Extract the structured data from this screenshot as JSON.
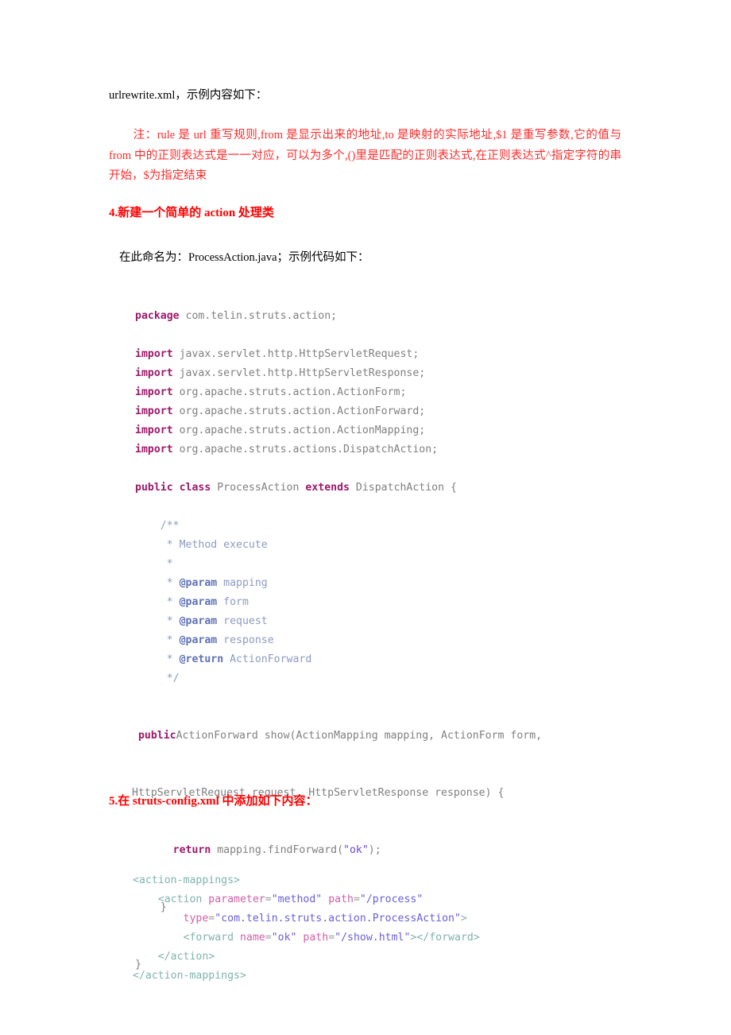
{
  "document": {
    "intro_line": "urlrewrite.xml，示例内容如下：",
    "note_paragraph": "注：rule 是 url 重写规则,from 是显示出来的地址,to 是映射的实际地址,$1 是重写参数,它的值与 from 中的正则表达式是一一对应，可以为多个,()里是匹配的正则表达式,在正则表达式^指定字符的串开始，$为指定结束",
    "section4_heading": "4.新建一个简单的 action 处理类",
    "section4_subtext": "在此命名为：ProcessAction.java；示例代码如下：",
    "section5_heading": "5.在 struts-config.xml 中添加如下内容："
  },
  "java_code": {
    "lines": [
      [
        {
          "t": "package",
          "c": "kw"
        },
        {
          "t": " com.telin.struts.action;",
          "c": "plain"
        }
      ],
      [],
      [
        {
          "t": "import",
          "c": "kw"
        },
        {
          "t": " javax.servlet.http.HttpServletRequest;",
          "c": "plain"
        }
      ],
      [
        {
          "t": "import",
          "c": "kw"
        },
        {
          "t": " javax.servlet.http.HttpServletResponse;",
          "c": "plain"
        }
      ],
      [
        {
          "t": "import",
          "c": "kw"
        },
        {
          "t": " org.apache.struts.action.ActionForm;",
          "c": "plain"
        }
      ],
      [
        {
          "t": "import",
          "c": "kw"
        },
        {
          "t": " org.apache.struts.action.ActionForward;",
          "c": "plain"
        }
      ],
      [
        {
          "t": "import",
          "c": "kw"
        },
        {
          "t": " org.apache.struts.action.ActionMapping;",
          "c": "plain"
        }
      ],
      [
        {
          "t": "import",
          "c": "kw"
        },
        {
          "t": " org.apache.struts.actions.DispatchAction;",
          "c": "plain"
        }
      ],
      [],
      [
        {
          "t": "public class",
          "c": "kw"
        },
        {
          "t": " ProcessAction ",
          "c": "plain"
        },
        {
          "t": "extends",
          "c": "kw"
        },
        {
          "t": " DispatchAction {",
          "c": "plain"
        }
      ],
      [],
      [
        {
          "t": "    /**",
          "c": "cmt"
        }
      ],
      [
        {
          "t": "     * Method execute",
          "c": "cmt"
        }
      ],
      [
        {
          "t": "     *",
          "c": "cmt"
        }
      ],
      [
        {
          "t": "     * ",
          "c": "cmt"
        },
        {
          "t": "@param",
          "c": "cmt-tag"
        },
        {
          "t": " mapping",
          "c": "cmt"
        }
      ],
      [
        {
          "t": "     * ",
          "c": "cmt"
        },
        {
          "t": "@param",
          "c": "cmt-tag"
        },
        {
          "t": " form",
          "c": "cmt"
        }
      ],
      [
        {
          "t": "     * ",
          "c": "cmt"
        },
        {
          "t": "@param",
          "c": "cmt-tag"
        },
        {
          "t": " request",
          "c": "cmt"
        }
      ],
      [
        {
          "t": "     * ",
          "c": "cmt"
        },
        {
          "t": "@param",
          "c": "cmt-tag"
        },
        {
          "t": " response",
          "c": "cmt"
        }
      ],
      [
        {
          "t": "     * ",
          "c": "cmt"
        },
        {
          "t": "@return",
          "c": "cmt-tag"
        },
        {
          "t": " ActionForward",
          "c": "cmt"
        }
      ],
      [
        {
          "t": "     */",
          "c": "cmt"
        }
      ]
    ],
    "signature_line_1": [
      {
        "t": " ",
        "c": "plain"
      },
      {
        "t": "public",
        "c": "kw"
      },
      {
        "t": "ActionForward show(ActionMapping mapping, ActionForm form,",
        "c": "plain"
      }
    ],
    "signature_line_2": [
      {
        "t": "HttpServletRequest request, HttpServletResponse response) {",
        "c": "plain"
      }
    ],
    "return_line": [
      {
        "t": "      ",
        "c": "plain"
      },
      {
        "t": "return",
        "c": "kw"
      },
      {
        "t": " mapping.findForward(",
        "c": "plain"
      },
      {
        "t": "\"ok\"",
        "c": "str"
      },
      {
        "t": ");",
        "c": "plain"
      }
    ],
    "close_inner": "    }",
    "close_outer": "}"
  },
  "xml_code": {
    "lines": [
      [
        {
          "t": "<action-mappings>",
          "c": "xtag"
        }
      ],
      [
        {
          "t": "    <action ",
          "c": "xtag"
        },
        {
          "t": "parameter",
          "c": "xattr"
        },
        {
          "t": "=",
          "c": "xpunct"
        },
        {
          "t": "\"method\"",
          "c": "xval"
        },
        {
          "t": " ",
          "c": "plain"
        },
        {
          "t": "path",
          "c": "xattr"
        },
        {
          "t": "=",
          "c": "xpunct"
        },
        {
          "t": "\"/process\"",
          "c": "xval"
        }
      ],
      [
        {
          "t": "        ",
          "c": "plain"
        },
        {
          "t": "type",
          "c": "xattr"
        },
        {
          "t": "=",
          "c": "xpunct"
        },
        {
          "t": "\"com.telin.struts.action.ProcessAction\"",
          "c": "xval"
        },
        {
          "t": ">",
          "c": "xtag"
        }
      ],
      [
        {
          "t": "        <forward ",
          "c": "xtag"
        },
        {
          "t": "name",
          "c": "xattr"
        },
        {
          "t": "=",
          "c": "xpunct"
        },
        {
          "t": "\"ok\"",
          "c": "xval"
        },
        {
          "t": " ",
          "c": "plain"
        },
        {
          "t": "path",
          "c": "xattr"
        },
        {
          "t": "=",
          "c": "xpunct"
        },
        {
          "t": "\"/show.html\"",
          "c": "xval"
        },
        {
          "t": "></forward>",
          "c": "xtag"
        }
      ],
      [
        {
          "t": "    </action>",
          "c": "xtag"
        }
      ],
      [
        {
          "t": "</action-mappings>",
          "c": "xtag"
        }
      ]
    ]
  },
  "colors": {
    "note_red": "#ff2a2a",
    "heading_red": "#ff0000",
    "keyword": "#9b1a6b",
    "code_plain": "#808080",
    "comment": "#8c9bbf",
    "comment_tag": "#5f73b5",
    "string": "#6a46d6",
    "xml_tag": "#7fb3ac",
    "xml_attr": "#cf5fa8",
    "xml_value": "#6a5fd6"
  }
}
